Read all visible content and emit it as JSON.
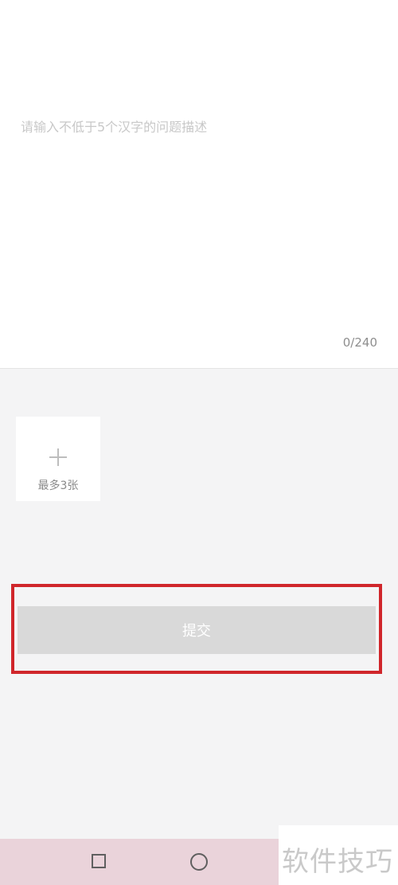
{
  "feedback": {
    "placeholder": "请输入不低于5个汉字的问题描述",
    "counter": "0/240"
  },
  "upload": {
    "icon": "plus-icon",
    "label": "最多3张"
  },
  "submit": {
    "label": "提交"
  },
  "highlight": {
    "color": "#d0262b"
  },
  "navigation": {
    "icons": [
      "square-icon",
      "circle-icon"
    ]
  },
  "watermark": {
    "text": "软件技巧"
  }
}
